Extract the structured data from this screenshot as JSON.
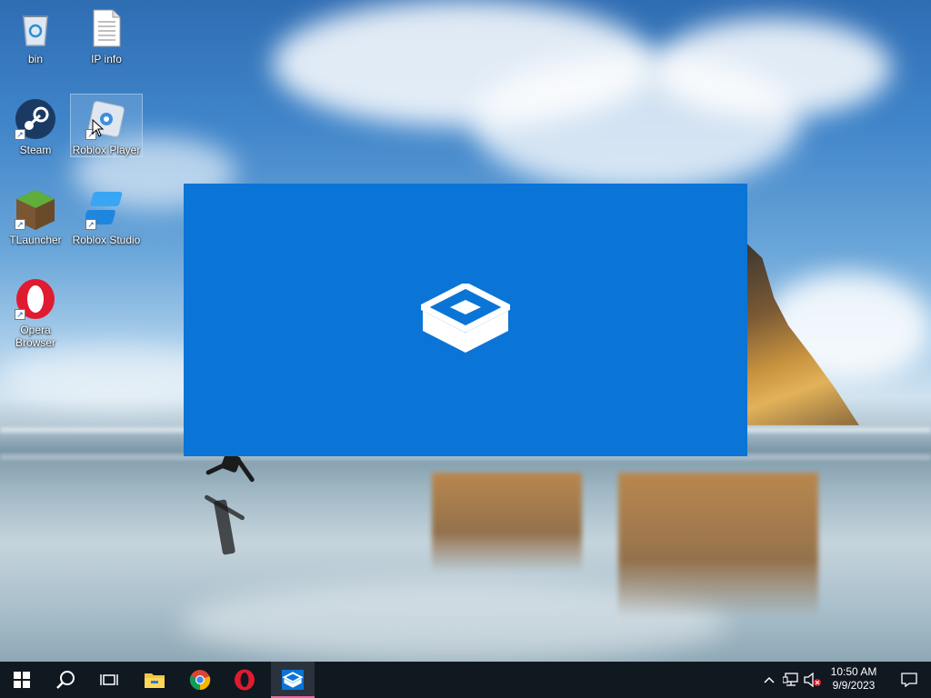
{
  "desktop": {
    "icons": [
      {
        "label": "bin",
        "icon": "recycle-bin-icon"
      },
      {
        "label": "IP info",
        "icon": "text-file-icon"
      },
      {
        "label": "Steam",
        "icon": "steam-icon"
      },
      {
        "label": "Roblox Player",
        "icon": "roblox-player-icon"
      },
      {
        "label": "TLauncher",
        "icon": "tlauncher-icon"
      },
      {
        "label": "Roblox Studio",
        "icon": "roblox-studio-icon"
      },
      {
        "label": "Opera Browser",
        "icon": "opera-icon"
      }
    ]
  },
  "splash": {
    "icon": "sandbox-box-icon",
    "background_color": "#0b74d7"
  },
  "taskbar": {
    "pinned": [
      {
        "name": "start",
        "icon": "windows-logo-icon"
      },
      {
        "name": "search",
        "icon": "search-icon"
      },
      {
        "name": "task-view",
        "icon": "task-view-icon"
      },
      {
        "name": "file-explorer",
        "icon": "folder-icon"
      },
      {
        "name": "chrome",
        "icon": "chrome-icon"
      },
      {
        "name": "opera",
        "icon": "opera-icon"
      },
      {
        "name": "windows-sandbox",
        "icon": "sandbox-box-icon",
        "active": true
      }
    ],
    "tray": {
      "time": "10:50 AM",
      "date": "9/9/2023"
    },
    "accent_color": "#e76aa6"
  }
}
